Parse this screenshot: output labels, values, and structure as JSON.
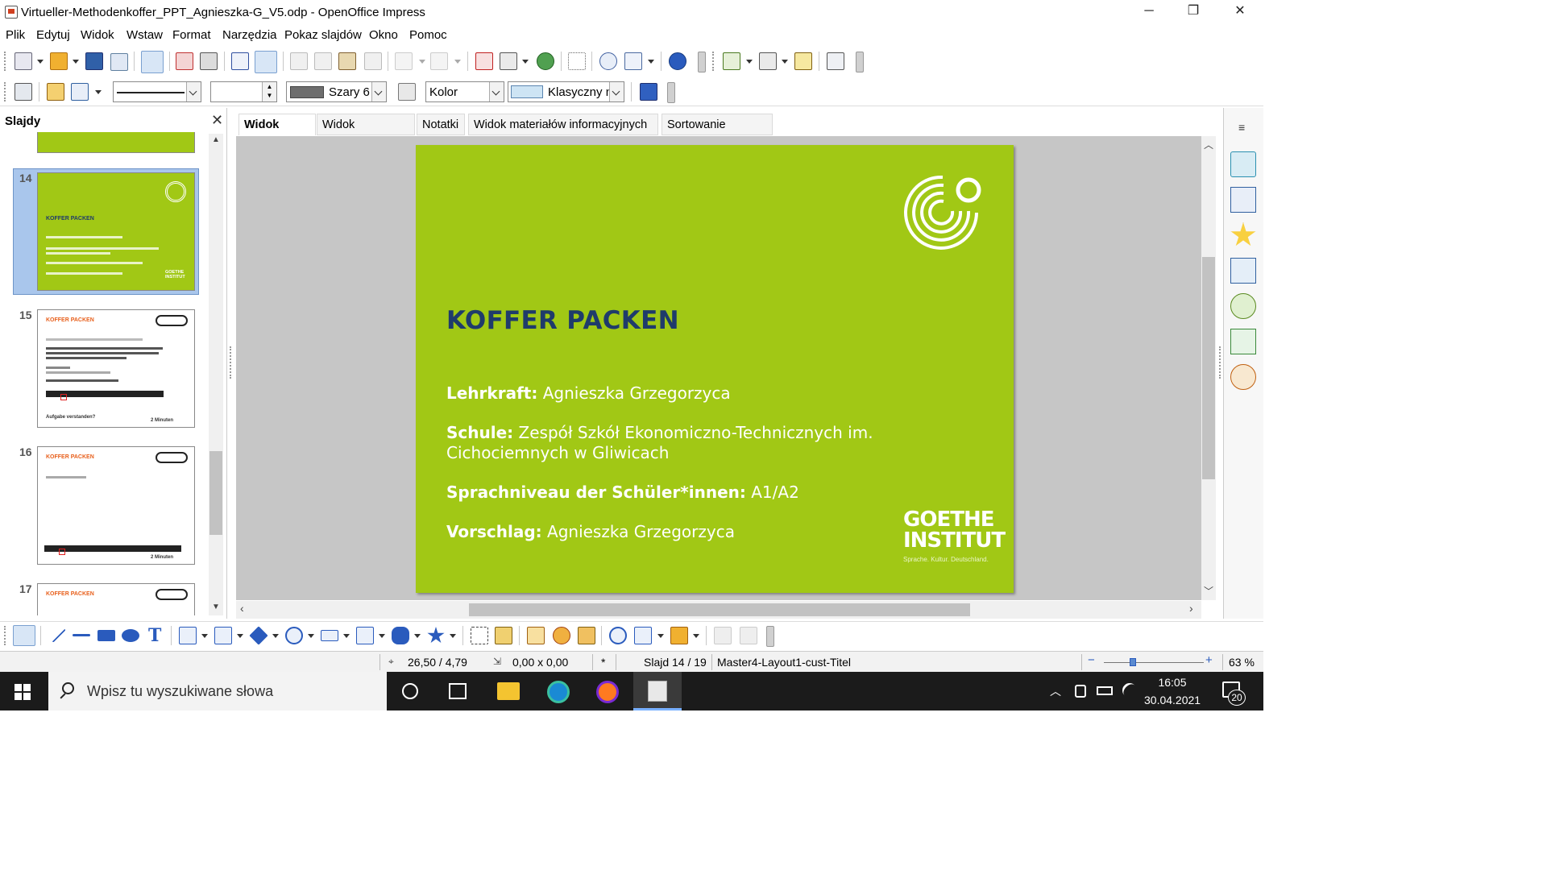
{
  "window": {
    "title": "Virtueller-Methodenkoffer_PPT_Agnieszka-G_V5.odp - OpenOffice Impress",
    "controls": [
      "─",
      "❐",
      "✕"
    ]
  },
  "menu": [
    "Plik",
    "Edytuj",
    "Widok",
    "Wstaw",
    "Format",
    "Narzędzia",
    "Pokaz slajdów",
    "Okno",
    "Pomoc"
  ],
  "line_toolbar": {
    "line_style_value": "",
    "line_width_value": "",
    "line_color_value": "Szary 6",
    "area_style_value": "Kolor",
    "area_fill_value": "Klasyczny n"
  },
  "slide_panel": {
    "title": "Slajdy",
    "close": "✕",
    "thumbnails": [
      {
        "number": "14",
        "title": "KOFFER PACKEN",
        "selected": true,
        "style": "green"
      },
      {
        "number": "15",
        "title": "KOFFER PACKEN",
        "selected": false,
        "style": "white",
        "footer": "Aufgabe verstanden?",
        "timer": "2 Minuten"
      },
      {
        "number": "16",
        "title": "KOFFER PACKEN",
        "selected": false,
        "style": "white",
        "footer": "",
        "timer": "2 Minuten"
      },
      {
        "number": "17",
        "title": "KOFFER PACKEN",
        "selected": false,
        "style": "white",
        "footer": "",
        "timer": ""
      }
    ]
  },
  "view_tabs": [
    "Widok slajdu",
    "Widok konspektu",
    "Notatki",
    "Widok materiałów informacyjnych",
    "Sortowanie slajdów"
  ],
  "slide": {
    "heading": "KOFFER PACKEN",
    "fields": [
      {
        "label": "Lehrkraft:",
        "value": "Agnieszka Grzegorzyca"
      },
      {
        "label": "Schule:",
        "value": "Zespół Szkół Ekonomiczno-Technicznych im. Cichociemnych w Gliwicach"
      },
      {
        "label": "Sprachniveau der Schüler*innen:",
        "value": "A1/A2"
      },
      {
        "label": "Vorschlag:",
        "value": "Agnieszka Grzegorzyca"
      }
    ],
    "logo_line1": "GOETHE",
    "logo_line2": "INSTITUT",
    "logo_tagline": "Sprache. Kultur. Deutschland.",
    "background": "#a1c815",
    "heading_color": "#1f3b6b"
  },
  "status_bar": {
    "position": "26,50 / 4,79",
    "size": "0,00 x 0,00",
    "modified": "*",
    "slide": "Slajd 14 / 19",
    "layout": "Master4-Layout1-cust-Titel",
    "zoom": "63 %",
    "zoom_minus": "−",
    "zoom_plus": "+"
  },
  "taskbar": {
    "search_placeholder": "Wpisz tu wyszukiwane słowa",
    "time": "16:05",
    "date": "30.04.2021",
    "notifications": "20"
  }
}
